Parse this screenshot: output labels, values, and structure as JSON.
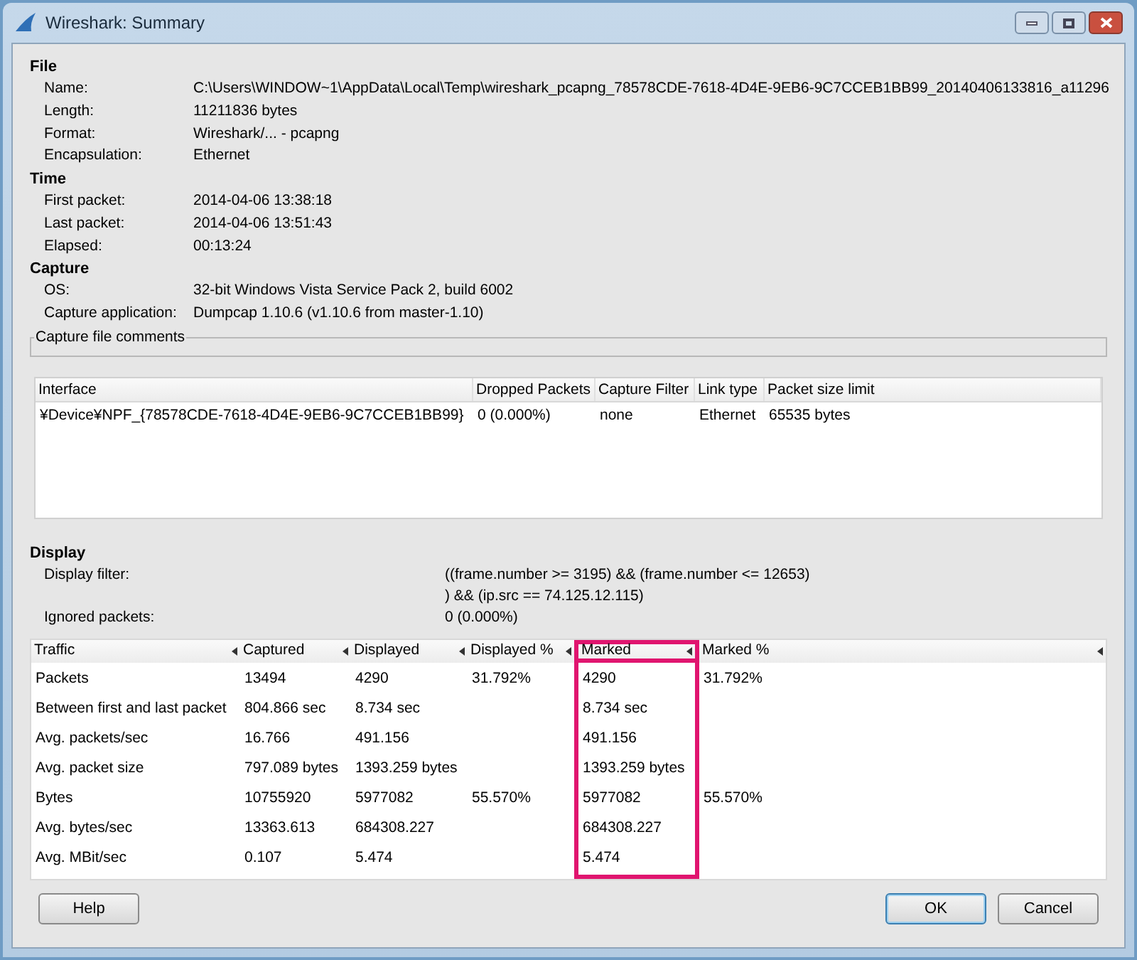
{
  "window": {
    "title": "Wireshark: Summary"
  },
  "sections": [
    {
      "title": "File",
      "rows": [
        {
          "label": "Name:",
          "value": "C:\\Users\\WINDOW~1\\AppData\\Local\\Temp\\wireshark_pcapng_78578CDE-7618-4D4E-9EB6-9C7CCEB1BB99_20140406133816_a11296"
        },
        {
          "label": "Length:",
          "value": "11211836 bytes"
        },
        {
          "label": "Format:",
          "value": "Wireshark/... - pcapng"
        },
        {
          "label": "Encapsulation:",
          "value": "Ethernet"
        }
      ]
    },
    {
      "title": "Time",
      "rows": [
        {
          "label": "First packet:",
          "value": "2014-04-06 13:38:18"
        },
        {
          "label": "Last packet:",
          "value": "2014-04-06 13:51:43"
        },
        {
          "label": "Elapsed:",
          "value": "00:13:24"
        }
      ]
    },
    {
      "title": "Capture",
      "rows": [
        {
          "label": "OS:",
          "value": "32-bit Windows Vista Service Pack 2, build 6002"
        },
        {
          "label": "Capture application:",
          "value": "Dumpcap 1.10.6 (v1.10.6 from master-1.10)"
        }
      ]
    }
  ],
  "comments": {
    "title": "Capture file comments"
  },
  "interfaces": {
    "columns": [
      "Interface",
      "Dropped Packets",
      "Capture Filter",
      "Link type",
      "Packet size limit"
    ],
    "rows": [
      [
        "¥Device¥NPF_{78578CDE-7618-4D4E-9EB6-9C7CCEB1BB99}",
        "0 (0.000%)",
        "none",
        "Ethernet",
        "65535 bytes"
      ]
    ]
  },
  "display": {
    "title": "Display",
    "rows": [
      {
        "label": "Display filter:",
        "value": "((frame.number >= 3195) && (frame.number <= 12653)\n) && (ip.src == 74.125.12.115)"
      },
      {
        "label": "Ignored packets:",
        "value": "0 (0.000%)"
      }
    ]
  },
  "traffic": {
    "columns": [
      {
        "label": "Traffic",
        "highlighted": false
      },
      {
        "label": "Captured",
        "highlighted": false
      },
      {
        "label": "Displayed",
        "highlighted": false
      },
      {
        "label": "Displayed %",
        "highlighted": false
      },
      {
        "label": "Marked",
        "highlighted": true
      },
      {
        "label": "Marked %",
        "highlighted": false
      }
    ],
    "rows": [
      [
        "Packets",
        "13494",
        "4290",
        "31.792%",
        "4290",
        "31.792%"
      ],
      [
        "Between first and last packet",
        "804.866 sec",
        "8.734 sec",
        "",
        "8.734 sec",
        ""
      ],
      [
        "Avg. packets/sec",
        "16.766",
        "491.156",
        "",
        "491.156",
        ""
      ],
      [
        "Avg. packet size",
        "797.089 bytes",
        "1393.259 bytes",
        "",
        "1393.259 bytes",
        ""
      ],
      [
        "Bytes",
        "10755920",
        "5977082",
        "55.570%",
        "5977082",
        "55.570%"
      ],
      [
        "Avg. bytes/sec",
        "13363.613",
        "684308.227",
        "",
        "684308.227",
        ""
      ],
      [
        "Avg. MBit/sec",
        "0.107",
        "5.474",
        "",
        "5.474",
        ""
      ]
    ]
  },
  "buttons": [
    {
      "label": "Help",
      "kind": "help",
      "default": false
    },
    {
      "label": "OK",
      "kind": "ok",
      "default": true
    },
    {
      "label": "Cancel",
      "kind": "cancel",
      "default": false
    }
  ]
}
